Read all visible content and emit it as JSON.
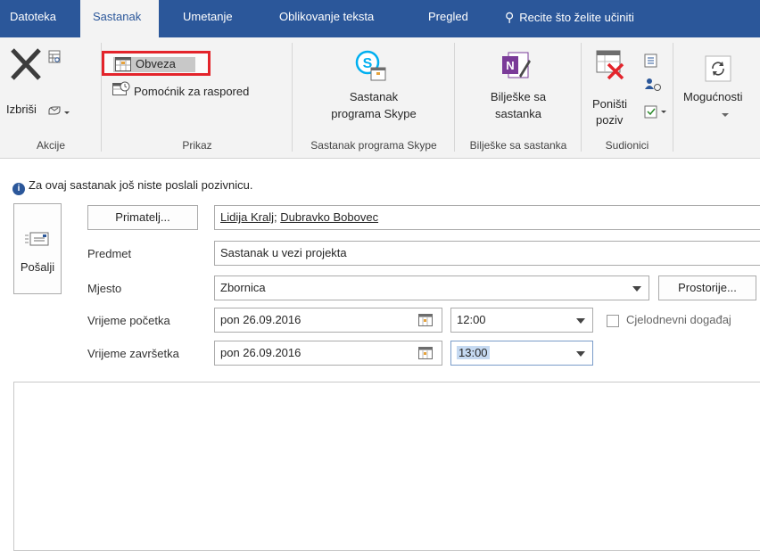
{
  "tabs": [
    {
      "label": "Datoteka",
      "active": false
    },
    {
      "label": "Sastanak",
      "active": true
    },
    {
      "label": "Umetanje",
      "active": false
    },
    {
      "label": "Oblikovanje teksta",
      "active": false
    },
    {
      "label": "Pregled",
      "active": false
    }
  ],
  "tell_me": "Recite što želite učiniti",
  "ribbon": {
    "akcije": {
      "delete_label": "Izbriši",
      "group_label": "Akcije"
    },
    "prikaz": {
      "obveza_label": "Obveza",
      "pomocnik_label": "Pomoćnik za raspored",
      "group_label": "Prikaz"
    },
    "skype": {
      "btn_line1": "Sastanak",
      "btn_line2": "programa Skype",
      "group_label": "Sastanak programa Skype"
    },
    "notes": {
      "btn_line1": "Bilješke sa",
      "btn_line2": "sastanka",
      "group_label": "Bilješke sa sastanka"
    },
    "sudionici": {
      "btn_line1": "Poništi",
      "btn_line2": "poziv",
      "group_label": "Sudionici"
    },
    "mogucnosti": {
      "label": "Mogućnosti"
    }
  },
  "info_text": "Za ovaj sastanak još niste poslali pozivnicu.",
  "form": {
    "send_label": "Pošalji",
    "to_button": "Primatelj...",
    "recipients": [
      "Lidija Kralj",
      "Dubravko Bobovec"
    ],
    "recipient_sep": ";",
    "subject_label": "Predmet",
    "subject_value": "Sastanak u vezi projekta",
    "location_label": "Mjesto",
    "location_value": "Zbornica",
    "rooms_button": "Prostorije...",
    "start_label": "Vrijeme početka",
    "start_date": "pon 26.09.2016",
    "start_time": "12:00",
    "allday_label": "Cjelodnevni događaj",
    "end_label": "Vrijeme završetka",
    "end_date": "pon 26.09.2016",
    "end_time": "13:00"
  },
  "colors": {
    "accent": "#2b579a",
    "highlight_border": "#e3242b",
    "selection": "#c5d9f1"
  }
}
